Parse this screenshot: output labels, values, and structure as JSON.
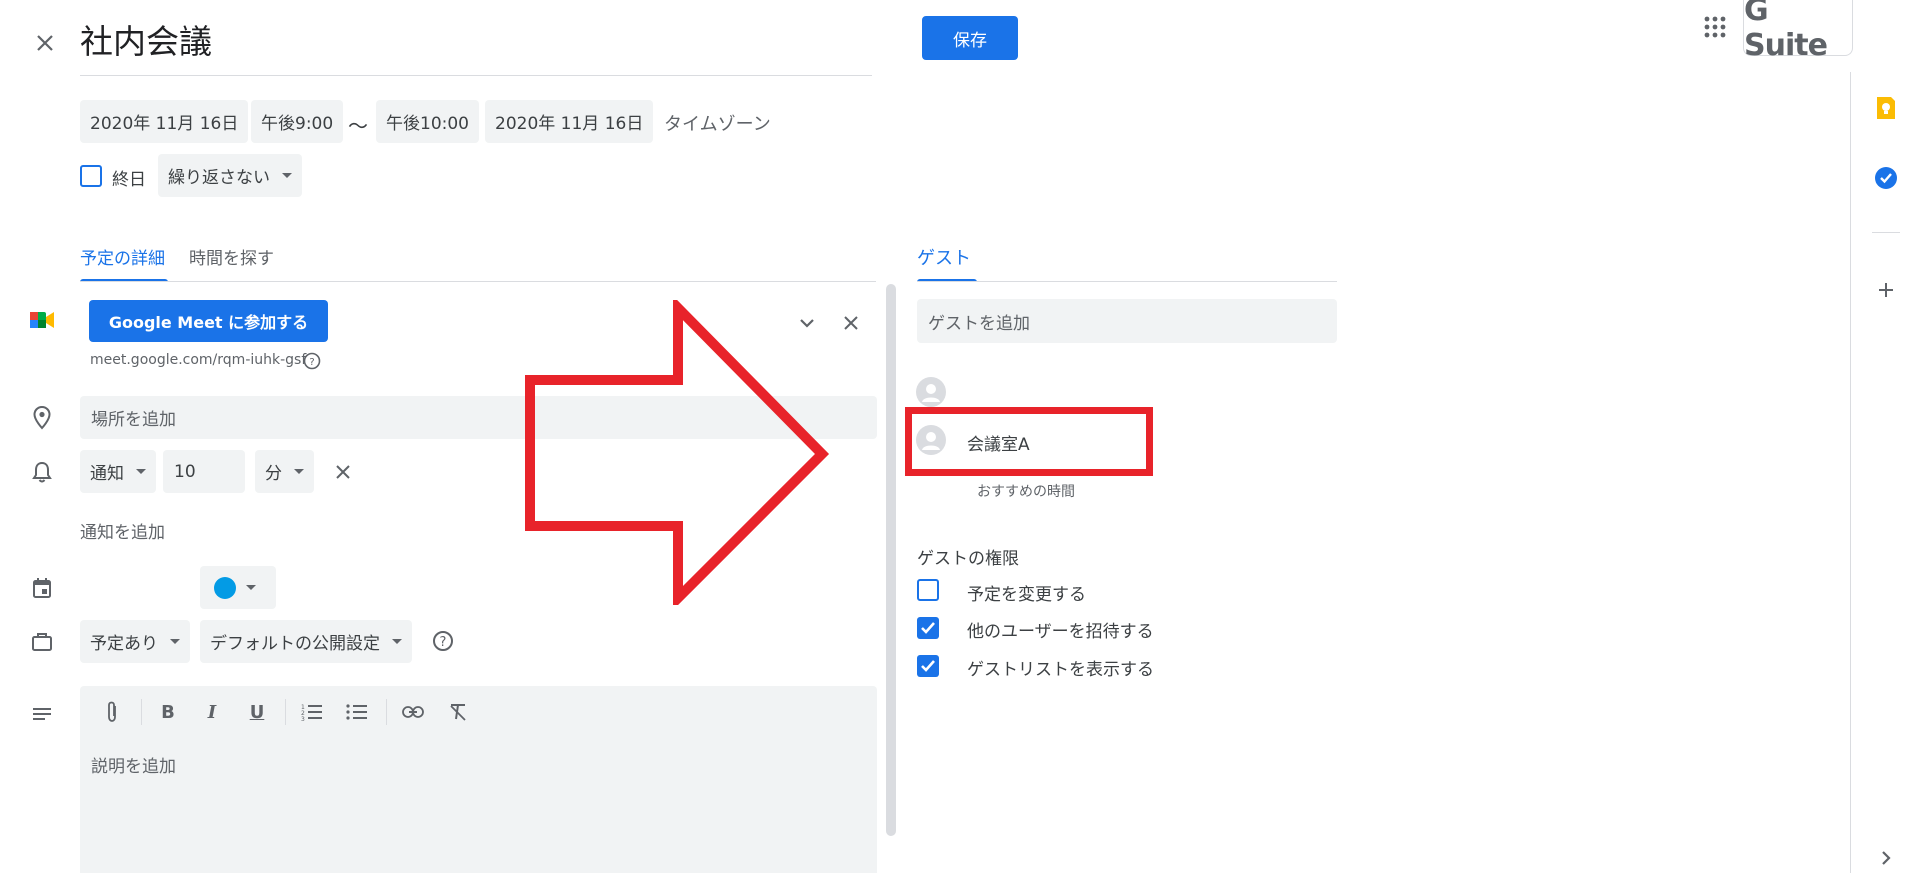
{
  "header": {
    "title": "社内会議",
    "save_label": "保存",
    "brand": "G Suite"
  },
  "datetime": {
    "start_date": "2020年 11月 16日",
    "start_time": "午後9:00",
    "separator": "〜",
    "end_time": "午後10:00",
    "end_date": "2020年 11月 16日",
    "timezone_label": "タイムゾーン",
    "all_day_label": "終日",
    "repeat_value": "繰り返さない"
  },
  "tabs": {
    "details": "予定の詳細",
    "find_time": "時間を探す",
    "guests": "ゲスト"
  },
  "meet": {
    "join_label": "Google Meet に参加する",
    "link": "meet.google.com/rqm-iuhk-gsf"
  },
  "location": {
    "placeholder": "場所を追加"
  },
  "notification": {
    "type": "通知",
    "value": "10",
    "unit": "分",
    "add_label": "通知を追加"
  },
  "status": {
    "busy": "予定あり",
    "visibility": "デフォルトの公開設定"
  },
  "description": {
    "placeholder": "説明を追加"
  },
  "guests": {
    "add_placeholder": "ゲストを追加",
    "room_name": "会議室A",
    "suggested_times": "おすすめの時間",
    "permissions_title": "ゲストの権限",
    "permissions": [
      {
        "label": "予定を変更する",
        "checked": false
      },
      {
        "label": "他のユーザーを招待する",
        "checked": true
      },
      {
        "label": "ゲストリストを表示する",
        "checked": true
      }
    ]
  },
  "colors": {
    "accent": "#1a73e8",
    "annotation": "#e8232a",
    "event_color": "#039be5",
    "keep": "#fbbc04"
  }
}
